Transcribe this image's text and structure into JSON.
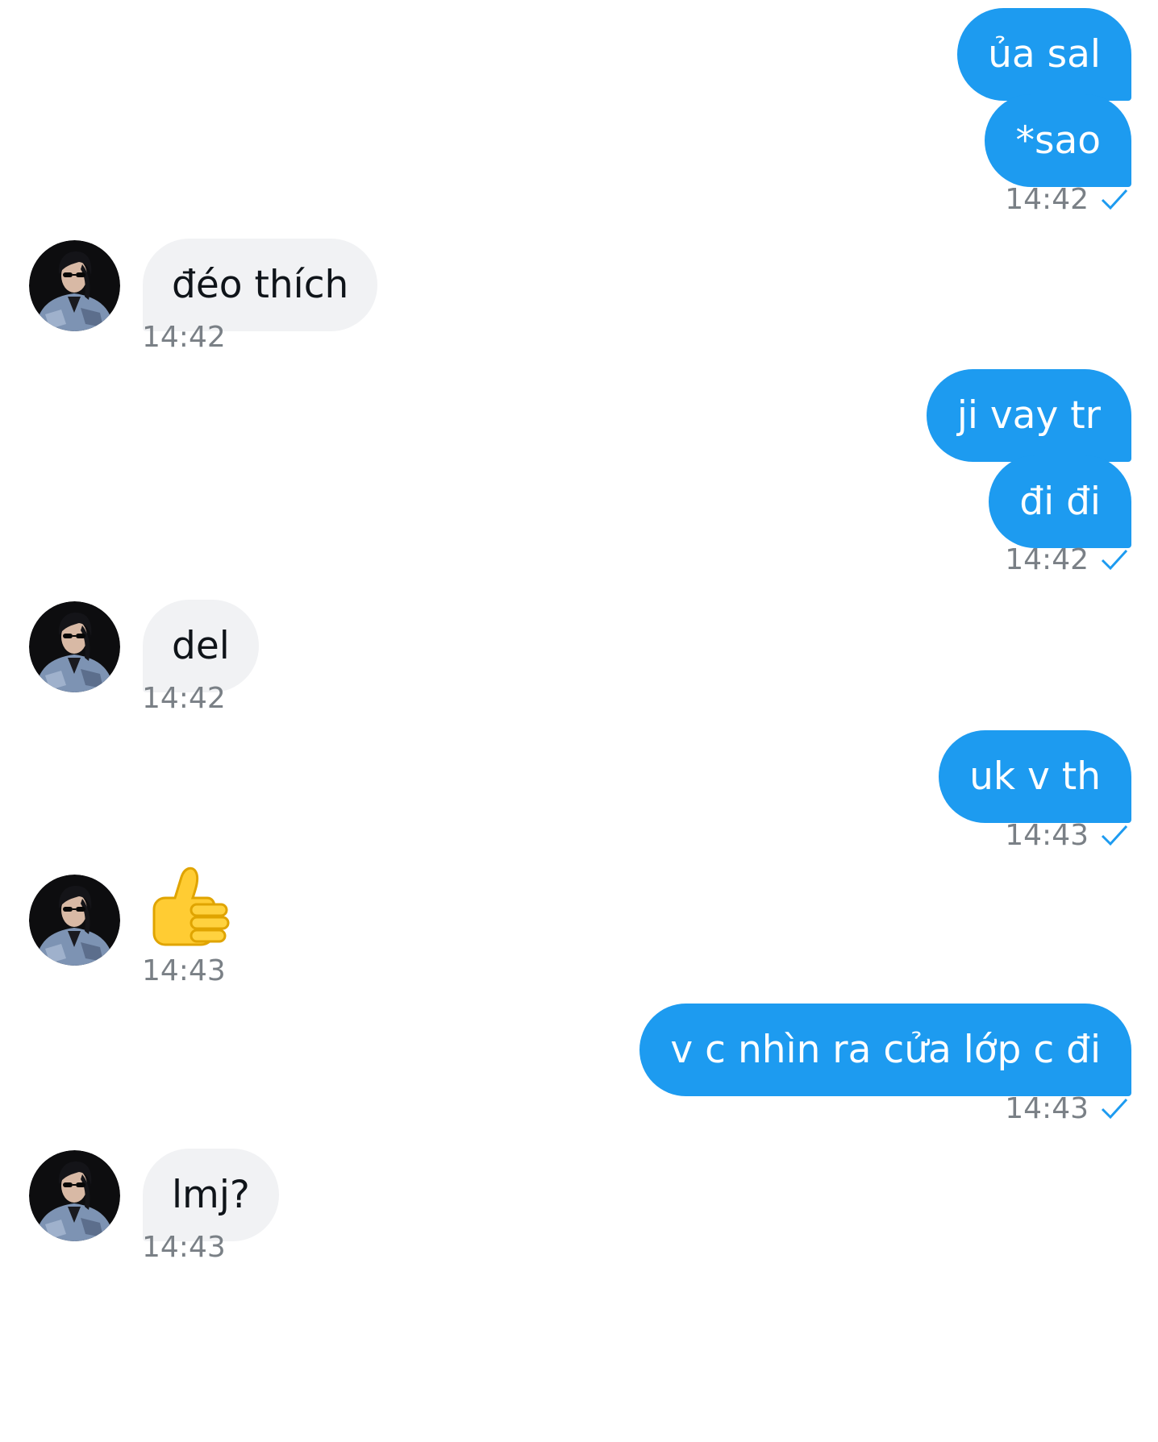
{
  "colors": {
    "outgoing_bubble": "#1d9bf0",
    "incoming_bubble": "#f1f2f4",
    "timestamp": "#7a8086",
    "read_check": "#1d9bf0"
  },
  "messages": [
    {
      "direction": "outgoing",
      "text": "ủa sal"
    },
    {
      "direction": "outgoing",
      "text": "*sao",
      "time": "14:42",
      "read_icon": "check-icon"
    },
    {
      "direction": "incoming",
      "text": "đéo thích",
      "time": "14:42",
      "avatar": "avatar"
    },
    {
      "direction": "outgoing",
      "text": "ji vay tr"
    },
    {
      "direction": "outgoing",
      "text": "đi đi",
      "time": "14:42",
      "read_icon": "check-icon"
    },
    {
      "direction": "incoming",
      "text": "del",
      "time": "14:42",
      "avatar": "avatar"
    },
    {
      "direction": "outgoing",
      "text": "uk v th",
      "time": "14:43",
      "read_icon": "check-icon"
    },
    {
      "direction": "incoming",
      "emoji": "thumbs-up-icon",
      "time": "14:43",
      "avatar": "avatar"
    },
    {
      "direction": "outgoing",
      "text": "v c nhìn ra cửa lớp c đi",
      "time": "14:43",
      "read_icon": "check-icon"
    },
    {
      "direction": "incoming",
      "text": "lmj?",
      "time": "14:43",
      "avatar": "avatar"
    }
  ]
}
